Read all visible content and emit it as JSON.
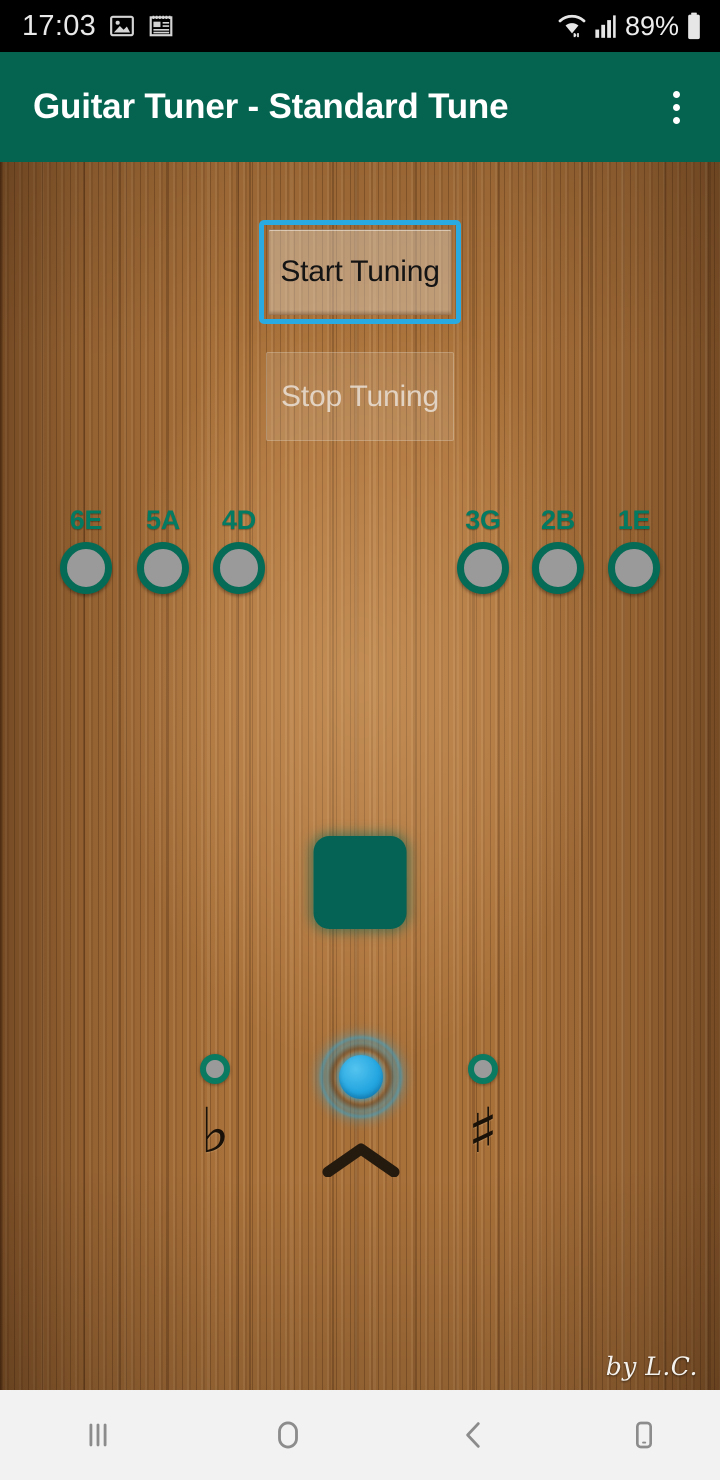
{
  "status_bar": {
    "clock": "17:03",
    "battery_percent": "89%",
    "icons": [
      "gallery-image-icon",
      "notepad-icon",
      "wifi-icon",
      "cellular-signal-icon",
      "battery-icon"
    ]
  },
  "app_bar": {
    "title": "Guitar Tuner - Standard Tune",
    "overflow_menu_label": "More options",
    "background_color": "#056450",
    "title_color": "#ffffff"
  },
  "controls": {
    "start_label": "Start Tuning",
    "stop_label": "Stop Tuning",
    "start_focused": true,
    "stop_enabled": false,
    "focus_color": "#29ABE2"
  },
  "strings": {
    "accent_color": "#057a62",
    "dot_color": "#9a9a9a",
    "left": [
      {
        "label": "6E",
        "note": "E",
        "number": "6",
        "active": false
      },
      {
        "label": "5A",
        "note": "A",
        "number": "5",
        "active": false
      },
      {
        "label": "4D",
        "note": "D",
        "number": "4",
        "active": false
      }
    ],
    "right": [
      {
        "label": "3G",
        "note": "G",
        "number": "3",
        "active": false
      },
      {
        "label": "2B",
        "note": "B",
        "number": "2",
        "active": false
      },
      {
        "label": "1E",
        "note": "E",
        "number": "1",
        "active": false
      }
    ]
  },
  "note_display": {
    "value": "",
    "background_color": "#046354"
  },
  "tuning_indicators": {
    "flat_symbol": "♭",
    "sharp_symbol": "♯",
    "center_icon": "chevron-up-icon",
    "flat_active": false,
    "sharp_active": false,
    "center_active": true,
    "active_color": "#29ABE2",
    "inactive_color": "#9a9a9a"
  },
  "signature": "by L.C.",
  "nav_bar": {
    "items": [
      {
        "name": "recents",
        "icon": "recents-icon"
      },
      {
        "name": "home",
        "icon": "home-icon"
      },
      {
        "name": "back",
        "icon": "back-chevron-icon"
      },
      {
        "name": "device",
        "icon": "device-icon"
      }
    ],
    "background_color": "#f2f2f2"
  }
}
